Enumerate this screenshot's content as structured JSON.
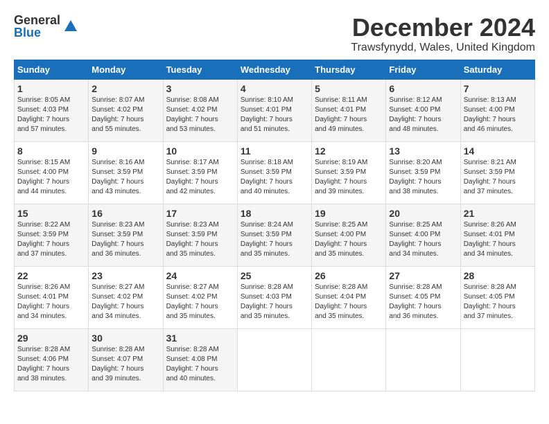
{
  "logo": {
    "general": "General",
    "blue": "Blue"
  },
  "title": "December 2024",
  "subtitle": "Trawsfynydd, Wales, United Kingdom",
  "days_header": [
    "Sunday",
    "Monday",
    "Tuesday",
    "Wednesday",
    "Thursday",
    "Friday",
    "Saturday"
  ],
  "weeks": [
    [
      {
        "day": "1",
        "info": "Sunrise: 8:05 AM\nSunset: 4:03 PM\nDaylight: 7 hours\nand 57 minutes."
      },
      {
        "day": "2",
        "info": "Sunrise: 8:07 AM\nSunset: 4:02 PM\nDaylight: 7 hours\nand 55 minutes."
      },
      {
        "day": "3",
        "info": "Sunrise: 8:08 AM\nSunset: 4:02 PM\nDaylight: 7 hours\nand 53 minutes."
      },
      {
        "day": "4",
        "info": "Sunrise: 8:10 AM\nSunset: 4:01 PM\nDaylight: 7 hours\nand 51 minutes."
      },
      {
        "day": "5",
        "info": "Sunrise: 8:11 AM\nSunset: 4:01 PM\nDaylight: 7 hours\nand 49 minutes."
      },
      {
        "day": "6",
        "info": "Sunrise: 8:12 AM\nSunset: 4:00 PM\nDaylight: 7 hours\nand 48 minutes."
      },
      {
        "day": "7",
        "info": "Sunrise: 8:13 AM\nSunset: 4:00 PM\nDaylight: 7 hours\nand 46 minutes."
      }
    ],
    [
      {
        "day": "8",
        "info": "Sunrise: 8:15 AM\nSunset: 4:00 PM\nDaylight: 7 hours\nand 44 minutes."
      },
      {
        "day": "9",
        "info": "Sunrise: 8:16 AM\nSunset: 3:59 PM\nDaylight: 7 hours\nand 43 minutes."
      },
      {
        "day": "10",
        "info": "Sunrise: 8:17 AM\nSunset: 3:59 PM\nDaylight: 7 hours\nand 42 minutes."
      },
      {
        "day": "11",
        "info": "Sunrise: 8:18 AM\nSunset: 3:59 PM\nDaylight: 7 hours\nand 40 minutes."
      },
      {
        "day": "12",
        "info": "Sunrise: 8:19 AM\nSunset: 3:59 PM\nDaylight: 7 hours\nand 39 minutes."
      },
      {
        "day": "13",
        "info": "Sunrise: 8:20 AM\nSunset: 3:59 PM\nDaylight: 7 hours\nand 38 minutes."
      },
      {
        "day": "14",
        "info": "Sunrise: 8:21 AM\nSunset: 3:59 PM\nDaylight: 7 hours\nand 37 minutes."
      }
    ],
    [
      {
        "day": "15",
        "info": "Sunrise: 8:22 AM\nSunset: 3:59 PM\nDaylight: 7 hours\nand 37 minutes."
      },
      {
        "day": "16",
        "info": "Sunrise: 8:23 AM\nSunset: 3:59 PM\nDaylight: 7 hours\nand 36 minutes."
      },
      {
        "day": "17",
        "info": "Sunrise: 8:23 AM\nSunset: 3:59 PM\nDaylight: 7 hours\nand 35 minutes."
      },
      {
        "day": "18",
        "info": "Sunrise: 8:24 AM\nSunset: 3:59 PM\nDaylight: 7 hours\nand 35 minutes."
      },
      {
        "day": "19",
        "info": "Sunrise: 8:25 AM\nSunset: 4:00 PM\nDaylight: 7 hours\nand 35 minutes."
      },
      {
        "day": "20",
        "info": "Sunrise: 8:25 AM\nSunset: 4:00 PM\nDaylight: 7 hours\nand 34 minutes."
      },
      {
        "day": "21",
        "info": "Sunrise: 8:26 AM\nSunset: 4:01 PM\nDaylight: 7 hours\nand 34 minutes."
      }
    ],
    [
      {
        "day": "22",
        "info": "Sunrise: 8:26 AM\nSunset: 4:01 PM\nDaylight: 7 hours\nand 34 minutes."
      },
      {
        "day": "23",
        "info": "Sunrise: 8:27 AM\nSunset: 4:02 PM\nDaylight: 7 hours\nand 34 minutes."
      },
      {
        "day": "24",
        "info": "Sunrise: 8:27 AM\nSunset: 4:02 PM\nDaylight: 7 hours\nand 35 minutes."
      },
      {
        "day": "25",
        "info": "Sunrise: 8:28 AM\nSunset: 4:03 PM\nDaylight: 7 hours\nand 35 minutes."
      },
      {
        "day": "26",
        "info": "Sunrise: 8:28 AM\nSunset: 4:04 PM\nDaylight: 7 hours\nand 35 minutes."
      },
      {
        "day": "27",
        "info": "Sunrise: 8:28 AM\nSunset: 4:05 PM\nDaylight: 7 hours\nand 36 minutes."
      },
      {
        "day": "28",
        "info": "Sunrise: 8:28 AM\nSunset: 4:05 PM\nDaylight: 7 hours\nand 37 minutes."
      }
    ],
    [
      {
        "day": "29",
        "info": "Sunrise: 8:28 AM\nSunset: 4:06 PM\nDaylight: 7 hours\nand 38 minutes."
      },
      {
        "day": "30",
        "info": "Sunrise: 8:28 AM\nSunset: 4:07 PM\nDaylight: 7 hours\nand 39 minutes."
      },
      {
        "day": "31",
        "info": "Sunrise: 8:28 AM\nSunset: 4:08 PM\nDaylight: 7 hours\nand 40 minutes."
      },
      null,
      null,
      null,
      null
    ]
  ]
}
